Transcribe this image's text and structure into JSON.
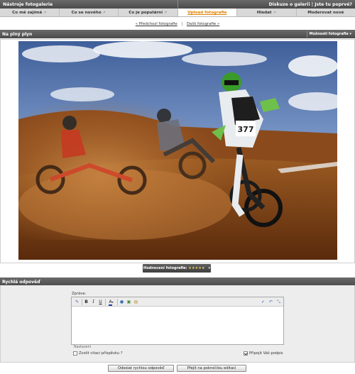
{
  "topbar": {
    "title": "Nástroje fotogalerie",
    "discussion": "Diskuze o galerii",
    "separator": "|",
    "first_time": "Jste tu poprvé?"
  },
  "tabs": [
    {
      "label": "Co mě zajímá",
      "active": false
    },
    {
      "label": "Co se nového",
      "active": false
    },
    {
      "label": "Co je populární",
      "active": false
    },
    {
      "label": "Upload fotografie",
      "active": true
    },
    {
      "label": "Hledat",
      "active": false
    },
    {
      "label": "Moderovat nové",
      "active": false
    }
  ],
  "nav": {
    "prev": "« Předchozí fotografie",
    "pipe": "|",
    "next": "Další fotografie »"
  },
  "photo_section": {
    "title": "Na plný plyn",
    "options": "Možnosti fotografie",
    "rider_number": "377"
  },
  "rating": {
    "label": "Hodnocení fotografie:",
    "stars": "★★★★★",
    "score": 5
  },
  "quick_reply": {
    "title": "Rychlá odpověď",
    "message_label": "Zpráva:",
    "settings_label": "Nastavení",
    "quote_label": "Zvolit citaci příspěvku ?",
    "quote_checked": false,
    "signature_label": "Připojit Váš podpis",
    "signature_checked": true,
    "send_button": "Odeslat rychlou odpověď",
    "advanced_button": "Přejít na pokročilou editaci"
  },
  "toolbar_icons": [
    "format-remove-icon",
    "bold-icon",
    "italic-icon",
    "underline-icon",
    "font-color-icon",
    "smiley-icon",
    "image-icon",
    "quote-icon",
    "spellcheck-icon",
    "undo-icon",
    "resize-icon"
  ],
  "colors": {
    "bar": "#555555",
    "tab_active_text": "#e08000",
    "panel": "#ededed",
    "stars": "#f2d35c"
  }
}
